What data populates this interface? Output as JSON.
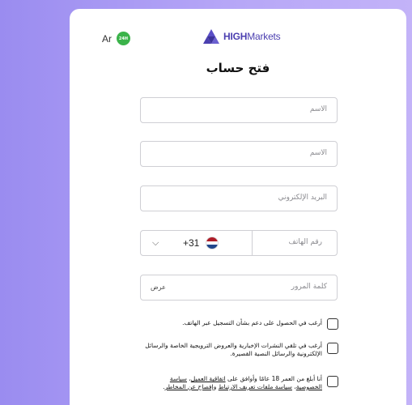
{
  "header": {
    "language_label": "Ar",
    "language_badge_text": "24H Trading",
    "logo_bold": "HIGH",
    "logo_rest": "Markets"
  },
  "form": {
    "title": "فتح حساب",
    "first_name_placeholder": "الاسم",
    "last_name_placeholder": "الاسم",
    "email_placeholder": "البريد الإلكتروني",
    "phone": {
      "country_code": "+31",
      "country_flag": "netherlands-flag",
      "placeholder": "رقم الهاتف"
    },
    "password_placeholder": "كلمة المرور",
    "show_password_label": "عرض",
    "checkboxes": [
      {
        "text": "أرغب في الحصول على دعم بشأن التسجيل عبر الهاتف.",
        "checked": false
      },
      {
        "text": "أرغب في تلقي النشرات الإخبارية والعروض الترويجية الخاصة والرسائل الإلكترونية والرسائل النصية القصيرة.",
        "checked": false
      },
      {
        "prefix": "أنا أبلغ من العمر 18 عامًا وأوافق على ",
        "link1": "اتفاقية العميل",
        "sep1": "، ",
        "link2": "سياسة الخصوصية",
        "sep2": "، ",
        "link3": "سياسة ملفات تعريف الارتباط",
        "sep3": " و",
        "link4": "إفصاح عن المخاطر",
        "suffix": ".",
        "checked": false
      }
    ]
  },
  "colors": {
    "background": "#a999f4",
    "brand": "#4b3fb0",
    "badge": "#3bb34a"
  }
}
